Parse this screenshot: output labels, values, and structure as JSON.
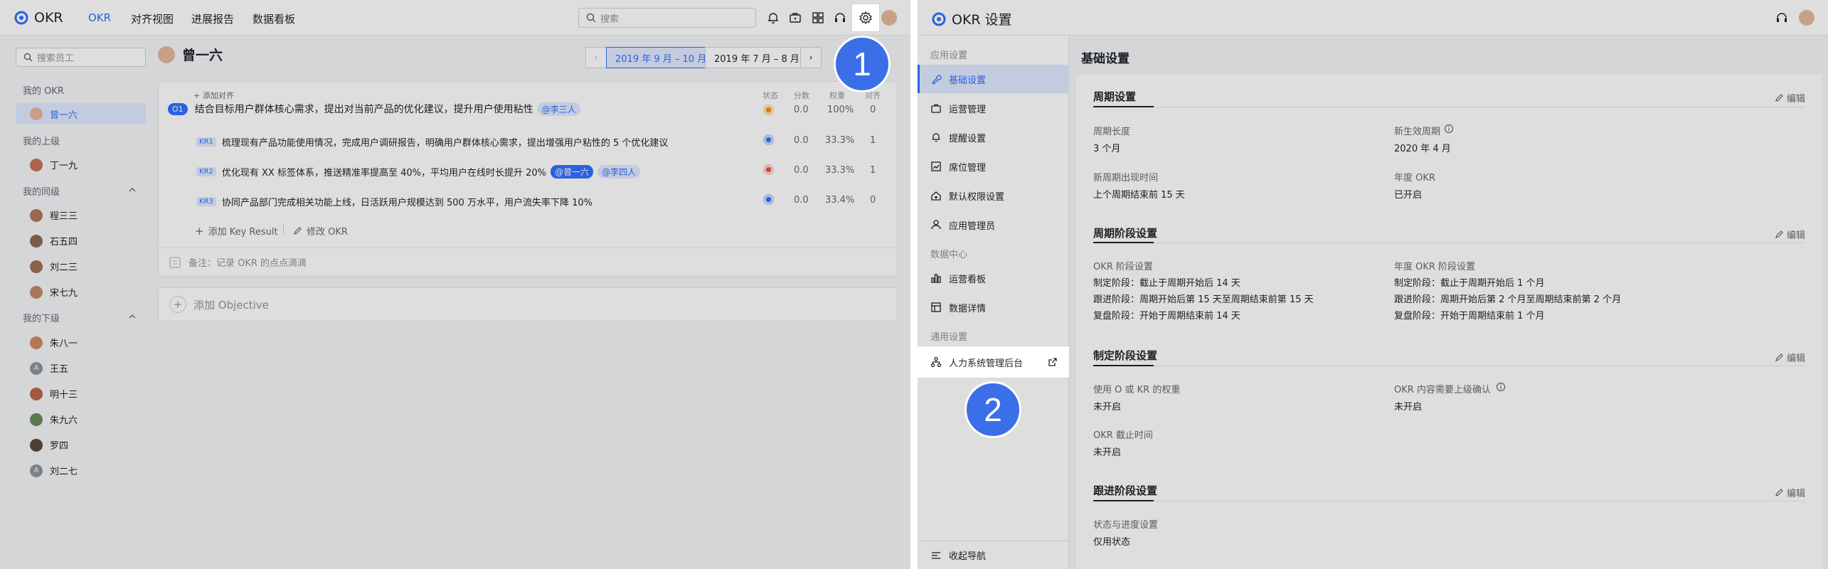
{
  "left": {
    "app_name": "OKR",
    "nav_tabs": [
      "OKR",
      "对齐视图",
      "进展报告",
      "数据看板"
    ],
    "search_placeholder": "搜索",
    "employee_search_placeholder": "搜索员工",
    "sidebar": {
      "my_okr_label": "我的 OKR",
      "me": "曾一六",
      "superior_label": "我的上级",
      "superior": "丁一九",
      "peers_label": "我的同级",
      "peers": [
        "程三三",
        "石五四",
        "刘二三",
        "宋七九"
      ],
      "reports_label": "我的下级",
      "reports": [
        "朱八一",
        "王五",
        "明十三",
        "朱九六",
        "罗四",
        "刘二七"
      ]
    },
    "user_name": "曾一六",
    "period_current": "2019 年 9 月 – 10 月",
    "period_prev": "2019 年 7 月 – 8 月",
    "columns": [
      "状态",
      "分数",
      "权重",
      "对齐"
    ],
    "add_align": "+ 添加对齐",
    "objective": {
      "badge": "O1",
      "text": "结合目标用户群体核心需求，提出对当前产品的优化建议，提升用户使用粘性",
      "mention": "@李三人",
      "score": "0.0",
      "weight": "100%",
      "align": "0"
    },
    "key_results": [
      {
        "badge": "KR1",
        "text": "梳理现有产品功能使用情况，完成用户调研报告，明确用户群体核心需求，提出增强用户粘性的 5 个优化建议",
        "mentions": [],
        "score": "0.0",
        "weight": "33.3%",
        "align": "1",
        "status_color": "#3370ff"
      },
      {
        "badge": "KR2",
        "text": "优化现有 XX 标签体系，推送精准率提高至 40%，平均用户在线时长提升 20%",
        "mentions": [
          "@曾一六",
          "@李四人"
        ],
        "score": "0.0",
        "weight": "33.3%",
        "align": "1",
        "status_color": "#f54a45"
      },
      {
        "badge": "KR3",
        "text": "协同产品部门完成相关功能上线，日活跃用户规模达到 500 万水平，用户流失率下降 10%",
        "mentions": [],
        "score": "0.0",
        "weight": "33.4%",
        "align": "0",
        "status_color": "#3370ff"
      }
    ],
    "objective_status_color": "#ff8800",
    "add_kr": "添加 Key Result",
    "edit_okr": "修改 OKR",
    "note": "备注：记录 OKR 的点点滴滴",
    "add_objective": "添加 Objective",
    "step_number": "1"
  },
  "right": {
    "title": "OKR 设置",
    "sidebar": {
      "app_settings_label": "应用设置",
      "app_items": [
        "基础设置",
        "运营管理",
        "提醒设置",
        "席位管理",
        "默认权限设置",
        "应用管理员"
      ],
      "data_center_label": "数据中心",
      "data_items": [
        "运营看板",
        "数据详情"
      ],
      "general_label": "通用设置",
      "general_items": [
        "人力系统管理后台"
      ],
      "collapse": "收起导航"
    },
    "page_title": "基础设置",
    "edit_label": "编辑",
    "sections": {
      "cycle": {
        "title": "周期设置",
        "length_label": "周期长度",
        "length_value": "3 个月",
        "effective_label": "新生效周期",
        "effective_value": "2020 年 4 月",
        "new_period_label": "新周期出现时间",
        "new_period_value": "上个周期结束前 15 天",
        "annual_label": "年度 OKR",
        "annual_value": "已开启"
      },
      "phase": {
        "title": "周期阶段设置",
        "okr_label": "OKR 阶段设置",
        "okr_lines": [
          "制定阶段：截止于周期开始后 14 天",
          "跟进阶段：周期开始后第 15 天至周期结束前第 15 天",
          "复盘阶段：开始于周期结束前 14 天"
        ],
        "annual_label": "年度 OKR 阶段设置",
        "annual_lines": [
          "制定阶段：截止于周期开始后 1 个月",
          "跟进阶段：周期开始后第 2 个月至周期结束前第 2 个月",
          "复盘阶段：开始于周期结束前 1 个月"
        ]
      },
      "define": {
        "title": "制定阶段设置",
        "weight_label": "使用 O 或 KR 的权重",
        "weight_value": "未开启",
        "confirm_label": "OKR 内容需要上级确认",
        "confirm_value": "未开启",
        "deadline_label": "OKR 截止时间",
        "deadline_value": "未开启"
      },
      "follow": {
        "title": "跟进阶段设置",
        "status_label": "状态与进度设置",
        "status_value": "仅用状态"
      }
    },
    "step_number": "2"
  },
  "colors": {
    "accent": "#3370ff",
    "step": "#3b6fe8"
  }
}
